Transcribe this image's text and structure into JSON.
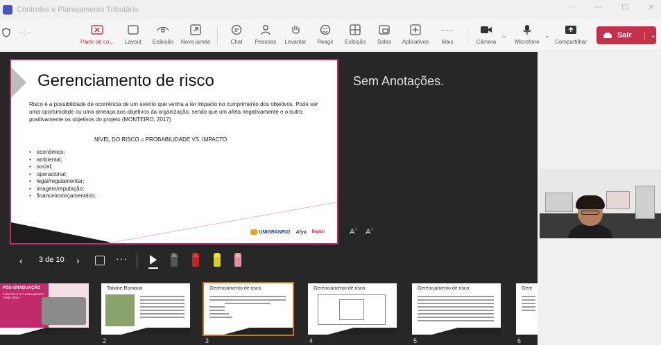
{
  "window": {
    "title": "Controles e Planejamento Tributário"
  },
  "toolbar": {
    "buttons": [
      {
        "label": "Parar de co...",
        "icon": "stop-share-icon"
      },
      {
        "label": "Layout",
        "icon": "layout-icon"
      },
      {
        "label": "Exibição",
        "icon": "eye-icon"
      },
      {
        "label": "Nova janela",
        "icon": "new-window-icon"
      },
      {
        "label": "Chat",
        "icon": "chat-icon"
      },
      {
        "label": "Pessoas",
        "icon": "people-icon"
      },
      {
        "label": "Levantar",
        "icon": "raise-hand-icon"
      },
      {
        "label": "Reagir",
        "icon": "react-icon"
      },
      {
        "label": "Exibição",
        "icon": "view-grid-icon"
      },
      {
        "label": "Salas",
        "icon": "rooms-icon"
      },
      {
        "label": "Aplicativos",
        "icon": "apps-icon"
      },
      {
        "label": "Mais",
        "icon": "more-icon"
      },
      {
        "label": "Câmera",
        "icon": "camera-icon"
      },
      {
        "label": "Microfone",
        "icon": "microphone-icon"
      },
      {
        "label": "Compartilhar",
        "icon": "share-icon"
      }
    ],
    "leave_label": "Sair",
    "leave_color": "#c4314b"
  },
  "slide": {
    "title": "Gerenciamento de risco",
    "body": "Risco é a possibilidade de ocorrência de um evento que venha a ter impacto no cumprimento dos objetivos. Pode ser uma oportunidade ou uma ameaça aos objetivos da organização, sendo que um afeta negativamente e o outro, positivamente os objetivos do projeto (MONTEIRO, 2017)",
    "subheading": "NÍVEL DO RISCO = PROBABILIDADE VS. IMPACTO",
    "bullets": [
      "econômico;",
      "ambiental;",
      "social;",
      "operacional;",
      "legal/regulamentar;",
      "imagem/reputação;",
      "financeiro/orçamentário."
    ],
    "logo_unigranrio": "UNIGRANRIO",
    "logo_afya": "Afya",
    "logo_digital": "Digital",
    "accent_color": "#c22b6b"
  },
  "notes": {
    "text": "Sem Anotações."
  },
  "font_controls": {
    "increase": "Aˆ",
    "decrease": "Aˇ"
  },
  "navigation": {
    "counter": "3 de 10"
  },
  "thumbnails": [
    {
      "number": "2",
      "title": "Tatiane Romana"
    },
    {
      "number": "3",
      "title": "Gerenciamento de risco"
    },
    {
      "number": "4",
      "title": "Gerenciamento de risco"
    },
    {
      "number": "5",
      "title": "Gerenciamento de risco"
    },
    {
      "number": "6",
      "title": "Gere"
    }
  ],
  "thumb_first": {
    "title": "PÓS-GRADUAÇÃO",
    "subtitle": "CONTROLE E PLANEJAMENTO TRIBUTÁRIO"
  }
}
